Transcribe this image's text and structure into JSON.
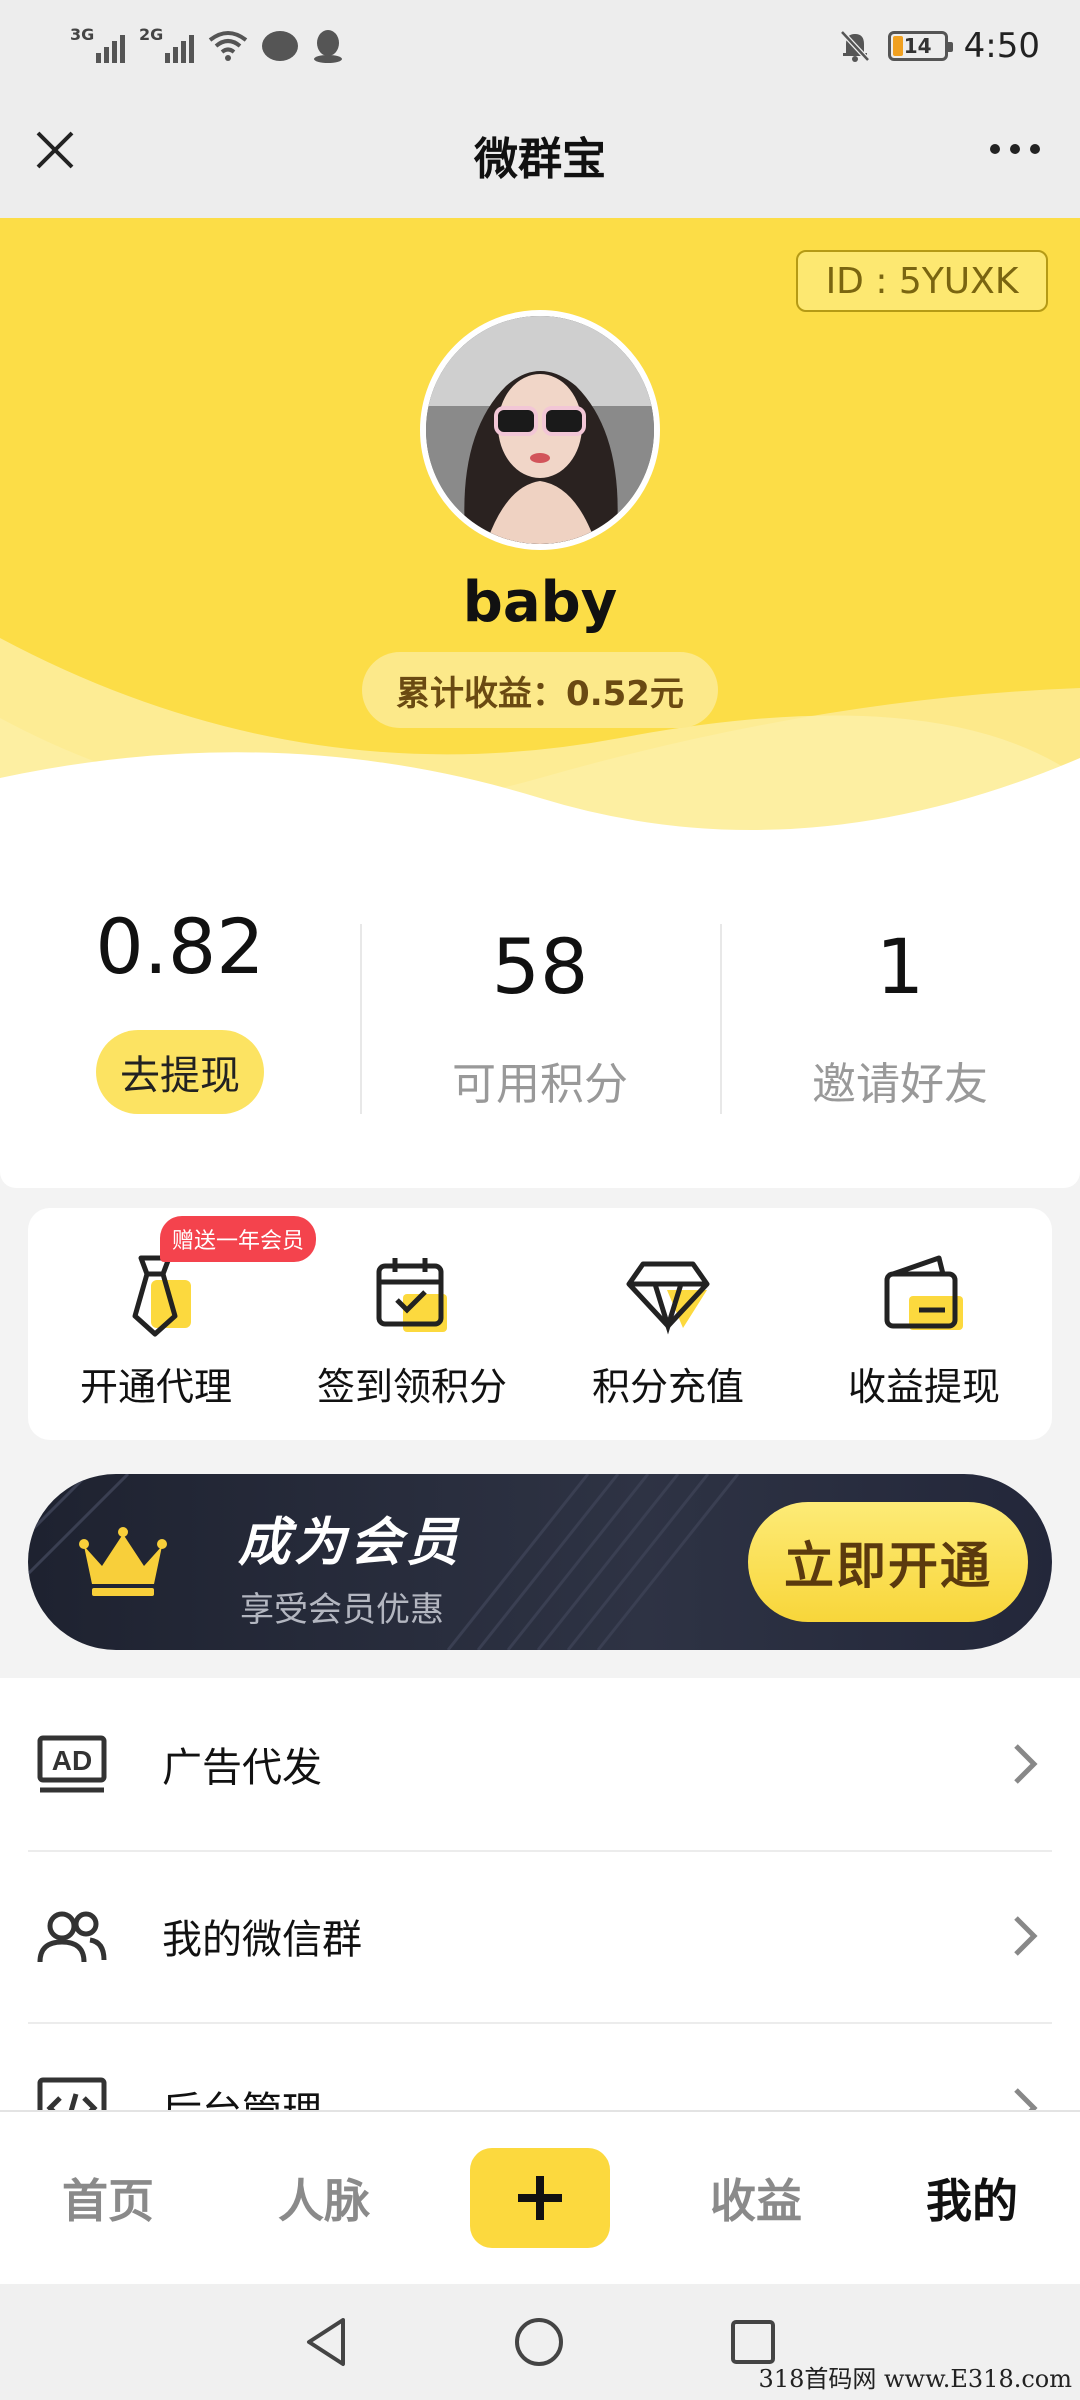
{
  "status_bar": {
    "signal_1_label": "3G",
    "signal_2_label": "2G",
    "battery": "14",
    "time": "4:50",
    "icons": [
      "signal-icon",
      "wifi-icon",
      "chat-bubble-icon",
      "qq-icon",
      "bell-off-icon",
      "battery-icon"
    ]
  },
  "nav": {
    "title": "微群宝"
  },
  "profile": {
    "id_label": "ID : 5YUXK",
    "username": "baby",
    "total_earnings": "累计收益：0.52元"
  },
  "stats": [
    {
      "value": "0.82",
      "label": "去提现"
    },
    {
      "value": "58",
      "label": "可用积分"
    },
    {
      "value": "1",
      "label": "邀请好友"
    }
  ],
  "quick_actions": [
    {
      "label": "开通代理",
      "badge": "赠送一年会员",
      "icon": "tie-icon"
    },
    {
      "label": "签到领积分",
      "icon": "calendar-check-icon"
    },
    {
      "label": "积分充值",
      "icon": "diamond-icon"
    },
    {
      "label": "收益提现",
      "icon": "wallet-icon"
    }
  ],
  "vip": {
    "title": "成为会员",
    "subtitle": "享受会员优惠",
    "button": "立即开通",
    "icon": "crown-icon"
  },
  "menu": [
    {
      "label": "广告代发",
      "icon": "ad-icon"
    },
    {
      "label": "我的微信群",
      "icon": "users-icon"
    },
    {
      "label": "后台管理",
      "icon": "code-icon"
    }
  ],
  "tabbar": {
    "items": [
      "首页",
      "人脉",
      "收益",
      "我的"
    ],
    "active": "我的"
  },
  "watermark": "318首码网 www.E318.com",
  "colors": {
    "brand_yellow": "#fcdd47",
    "vip_dark": "#262a38",
    "badge_red": "#f4434d"
  }
}
